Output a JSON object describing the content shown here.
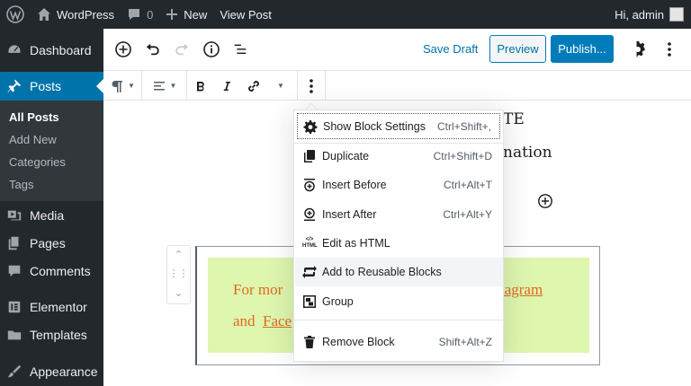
{
  "adminbar": {
    "site_name": "WordPress",
    "comments_count": "0",
    "new_label": "New",
    "view_post_label": "View Post",
    "greeting": "Hi, admin"
  },
  "sidebar": {
    "dashboard": "Dashboard",
    "posts": "Posts",
    "posts_sub": [
      "All Posts",
      "Add New",
      "Categories",
      "Tags"
    ],
    "media": "Media",
    "pages": "Pages",
    "comments": "Comments",
    "elementor": "Elementor",
    "templates": "Templates",
    "appearance": "Appearance"
  },
  "header": {
    "save_draft": "Save Draft",
    "preview": "Preview",
    "publish": "Publish..."
  },
  "content": {
    "partial_title": "TE",
    "partial_line": "nation",
    "highlight_line1_start": "For mor",
    "highlight_line1_link": "tagram",
    "highlight_line2_start": "and ",
    "highlight_line2_link": "Face"
  },
  "block_menu": {
    "items": [
      {
        "label": "Show Block Settings",
        "shortcut": "Ctrl+Shift+,"
      },
      {
        "label": "Duplicate",
        "shortcut": "Ctrl+Shift+D"
      },
      {
        "label": "Insert Before",
        "shortcut": "Ctrl+Alt+T"
      },
      {
        "label": "Insert After",
        "shortcut": "Ctrl+Alt+Y"
      },
      {
        "label": "Edit as HTML",
        "shortcut": ""
      },
      {
        "label": "Add to Reusable Blocks",
        "shortcut": ""
      },
      {
        "label": "Group",
        "shortcut": ""
      },
      {
        "label": "Remove Block",
        "shortcut": "Shift+Alt+Z"
      }
    ],
    "html_icon_text": "HTML"
  },
  "colors": {
    "admin_bg": "#23282d",
    "accent": "#0073aa",
    "highlight_bg": "#def6ae",
    "highlight_text": "#e06a22"
  }
}
